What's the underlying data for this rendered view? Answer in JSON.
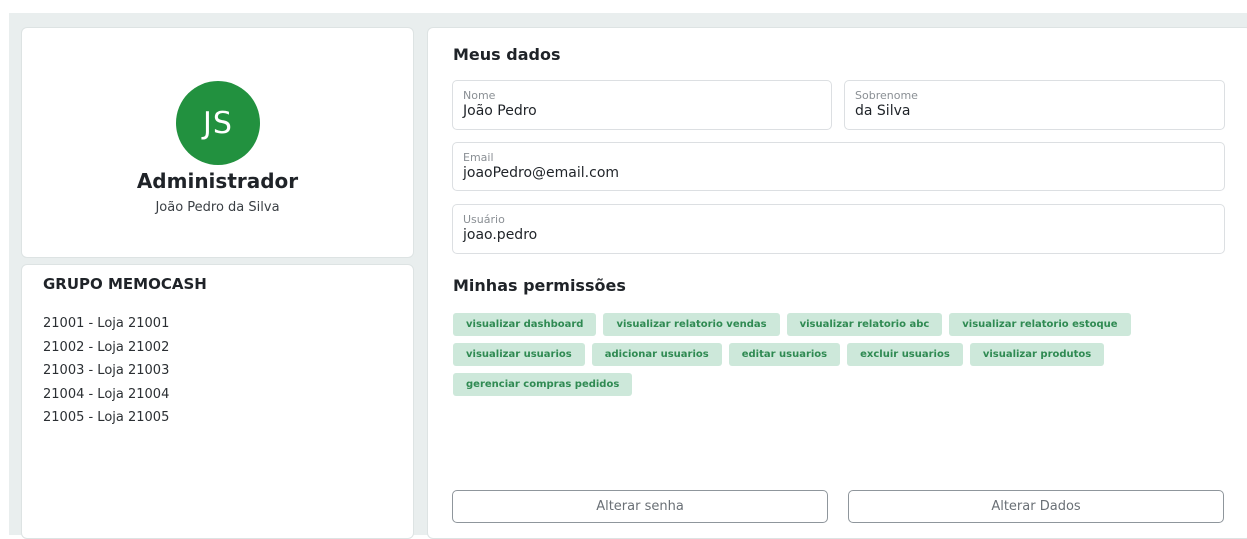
{
  "profile": {
    "initials": "JS",
    "role": "Administrador",
    "full_name": "João Pedro da Silva",
    "avatar_color": "#22913f"
  },
  "group": {
    "title": "GRUPO MEMOCASH",
    "stores": [
      "21001 - Loja 21001",
      "21002 - Loja 21002",
      "21003 - Loja 21003",
      "21004 - Loja 21004",
      "21005 - Loja 21005"
    ]
  },
  "my_data": {
    "title": "Meus dados",
    "first_name": {
      "label": "Nome",
      "value": "João Pedro"
    },
    "last_name": {
      "label": "Sobrenome",
      "value": "da Silva"
    },
    "email": {
      "label": "Email",
      "value": "joaoPedro@email.com"
    },
    "username": {
      "label": "Usuário",
      "value": "joao.pedro"
    }
  },
  "permissions": {
    "title": "Minhas permissões",
    "chip_color": "#cde8da",
    "chip_text_color": "#2f8a52",
    "items": [
      "visualizar dashboard",
      "visualizar relatorio vendas",
      "visualizar relatorio abc",
      "visualizar relatorio estoque",
      "visualizar usuarios",
      "adicionar usuarios",
      "editar usuarios",
      "excluir usuarios",
      "visualizar produtos",
      "gerenciar compras pedidos"
    ]
  },
  "actions": {
    "change_password": "Alterar senha",
    "change_data": "Alterar Dados"
  }
}
